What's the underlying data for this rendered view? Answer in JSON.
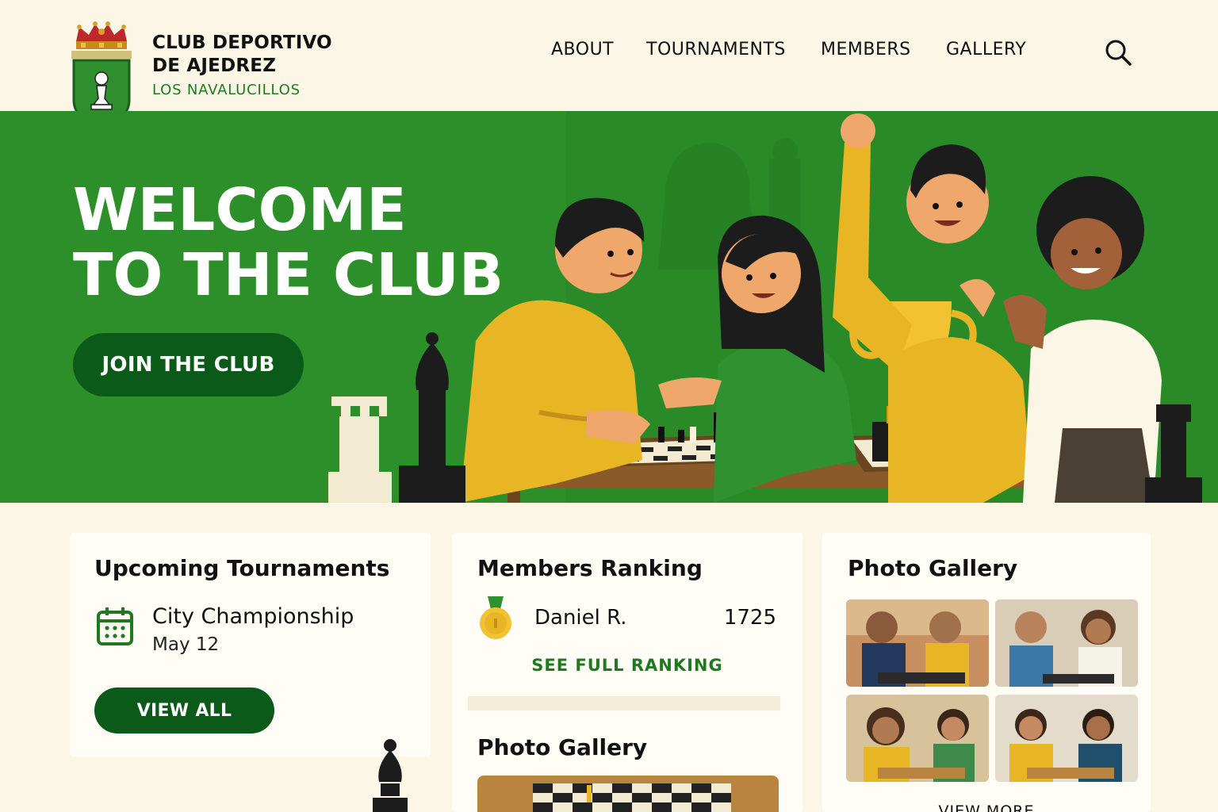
{
  "header": {
    "club_name_line1": "CLUB DEPORTIVO",
    "club_name_line2": "DE AJEDREZ",
    "club_location": "LOS NAVALUCILLOS",
    "logo_icon": "crest-pawn-icon",
    "nav": [
      {
        "label": "ABOUT"
      },
      {
        "label": "TOURNAMENTS"
      },
      {
        "label": "MEMBERS"
      },
      {
        "label": "GALLERY"
      }
    ],
    "search_icon": "search-icon"
  },
  "hero": {
    "title_line1": "WELCOME",
    "title_line2": "TO THE CLUB",
    "cta_label": "JOIN THE CLUB",
    "illustration": "friends-playing-chess-with-trophy"
  },
  "tournaments": {
    "title": "Upcoming Tournaments",
    "icon": "calendar-icon",
    "event_name": "City Championship",
    "event_date": "May 12",
    "button_label": "VIEW ALL"
  },
  "ranking": {
    "title": "Members Ranking",
    "icon": "medal-icon",
    "top_member": "Daniel R.",
    "top_score": "1725",
    "link_label": "SEE FULL RANKING",
    "gallery_title": "Photo Gallery"
  },
  "gallery": {
    "title": "Photo Gallery",
    "view_more": "VIEW MORE",
    "photos": [
      "chess-photo-1",
      "chess-photo-2",
      "chess-photo-3",
      "chess-photo-4"
    ]
  },
  "colors": {
    "background": "#fbf6e6",
    "hero_green": "#2d8f2a",
    "button_green": "#0c5a19",
    "link_green": "#1f7a1f",
    "card": "#fffdf5",
    "accent_yellow": "#e8b624"
  }
}
